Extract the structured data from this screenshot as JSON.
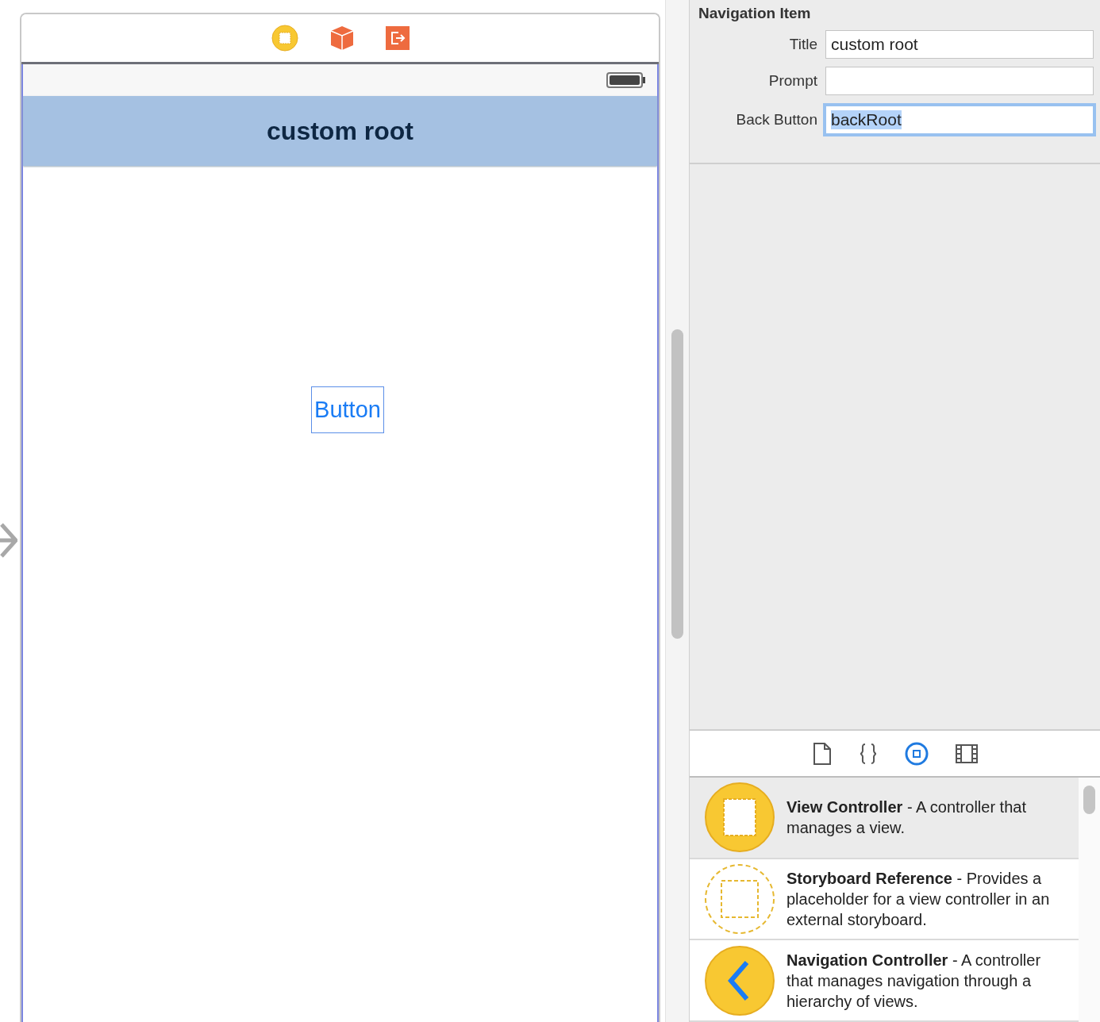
{
  "scene": {
    "dock_icons": [
      {
        "kind": "view-controller"
      },
      {
        "kind": "first-responder"
      },
      {
        "kind": "exit"
      }
    ],
    "navigation_bar": {
      "title": "custom root"
    },
    "button": {
      "label": "Button"
    }
  },
  "inspector": {
    "title": "Navigation Item",
    "fields": [
      {
        "label": "Title",
        "value": "custom root",
        "focused": false
      },
      {
        "label": "Prompt",
        "focused": false
      },
      {
        "label": "Back Button",
        "value": "backRoot",
        "focused": true
      }
    ]
  },
  "library": {
    "tabs": [
      {
        "kind": "file",
        "selected": false
      },
      {
        "kind": "braces",
        "selected": false
      },
      {
        "kind": "object",
        "selected": true
      },
      {
        "kind": "media",
        "selected": false
      }
    ],
    "items": [
      {
        "kind": "view-controller",
        "title": "View Controller",
        "description": "- A controller that manages a view.",
        "selected": true
      },
      {
        "kind": "storyboard-reference",
        "title": "Storyboard Reference",
        "description": "- Provides a placeholder for a view controller in an external storyboard.",
        "selected": false
      },
      {
        "kind": "navigation-controller",
        "title": "Navigation Controller",
        "description": "- A controller that manages navigation through a hierarchy of views.",
        "selected": false
      }
    ]
  }
}
